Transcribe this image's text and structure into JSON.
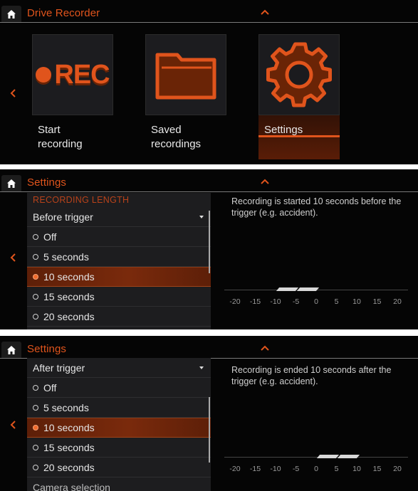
{
  "screens": [
    {
      "header_title": "Drive Recorder",
      "tiles": [
        {
          "label": "Start\nrecording",
          "icon": "rec-icon",
          "rec_text": "REC"
        },
        {
          "label": "Saved\nrecordings",
          "icon": "folder-icon"
        },
        {
          "label": "Settings",
          "icon": "gear-icon",
          "selected": true
        }
      ]
    },
    {
      "header_title": "Settings",
      "section_label": "RECORDING LENGTH",
      "dropdown_label": "Before trigger",
      "options": [
        "Off",
        "5 seconds",
        "10 seconds",
        "15 seconds",
        "20 seconds"
      ],
      "selected_option": "10 seconds",
      "description": "Recording is started 10 seconds before the trigger (e.g. accident).",
      "timeline_labels": [
        "-20",
        "-15",
        "-10",
        "-5",
        "0",
        "5",
        "10",
        "15",
        "20"
      ],
      "highlight_range": [
        -10,
        0
      ]
    },
    {
      "header_title": "Settings",
      "dropdown_label": "After trigger",
      "options": [
        "Off",
        "5 seconds",
        "10 seconds",
        "15 seconds",
        "20 seconds"
      ],
      "selected_option": "10 seconds",
      "next_item": "Camera selection",
      "description": "Recording is ended 10 seconds after the trigger (e.g. accident).",
      "timeline_labels": [
        "-20",
        "-15",
        "-10",
        "-5",
        "0",
        "5",
        "10",
        "15",
        "20"
      ],
      "highlight_range": [
        0,
        10
      ]
    }
  ],
  "colors": {
    "accent": "#e0541c",
    "background": "#050505",
    "panel": "#1d1d1f",
    "selected_row": "#7a2a0c"
  }
}
